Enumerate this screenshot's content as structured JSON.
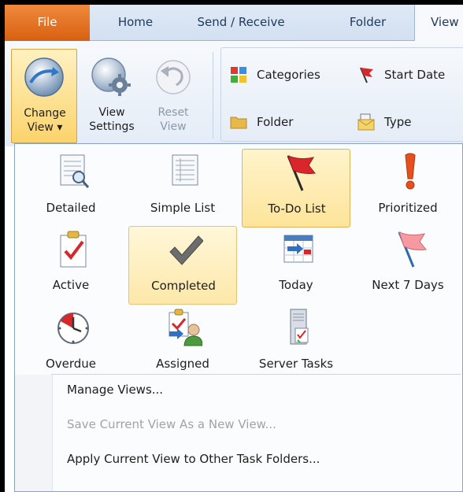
{
  "tabs": [
    {
      "label": "File"
    },
    {
      "label": "Home"
    },
    {
      "label": "Send / Receive"
    },
    {
      "label": "Folder"
    },
    {
      "label": "View"
    }
  ],
  "ribbon": {
    "change_view": {
      "line1": "Change",
      "line2": "View ▾"
    },
    "view_settings": {
      "line1": "View",
      "line2": "Settings"
    },
    "reset_view": {
      "line1": "Reset",
      "line2": "View"
    },
    "arrangement": [
      {
        "label": "Categories",
        "icon": "categories-icon"
      },
      {
        "label": "Start Date",
        "icon": "start-date-flag-icon"
      },
      {
        "label": "Folder",
        "icon": "folder-icon"
      },
      {
        "label": "Type",
        "icon": "type-envelope-icon"
      }
    ]
  },
  "gallery": [
    {
      "label": "Detailed",
      "icon": "detailed-view-icon",
      "state": "normal"
    },
    {
      "label": "Simple List",
      "icon": "simple-list-icon",
      "state": "normal"
    },
    {
      "label": "To-Do List",
      "icon": "todo-flag-icon",
      "state": "selected"
    },
    {
      "label": "Prioritized",
      "icon": "exclamation-icon",
      "state": "normal"
    },
    {
      "label": "Active",
      "icon": "active-clipboard-icon",
      "state": "normal"
    },
    {
      "label": "Completed",
      "icon": "checkmark-icon",
      "state": "hover"
    },
    {
      "label": "Today",
      "icon": "calendar-today-icon",
      "state": "normal"
    },
    {
      "label": "Next 7 Days",
      "icon": "next-7-days-flag-icon",
      "state": "normal"
    },
    {
      "label": "Overdue",
      "icon": "overdue-clock-icon",
      "state": "normal"
    },
    {
      "label": "Assigned",
      "icon": "assigned-icon",
      "state": "normal"
    },
    {
      "label": "Server Tasks",
      "icon": "server-tasks-icon",
      "state": "normal"
    }
  ],
  "menu_items": [
    {
      "label": "Manage Views...",
      "enabled": true
    },
    {
      "label": "Save Current View As a New View...",
      "enabled": false
    },
    {
      "label": "Apply Current View to Other Task Folders...",
      "enabled": true
    }
  ],
  "colors": {
    "file_tab": "#d85f12",
    "selection": "#fde49a",
    "flag_red": "#d8262b"
  }
}
